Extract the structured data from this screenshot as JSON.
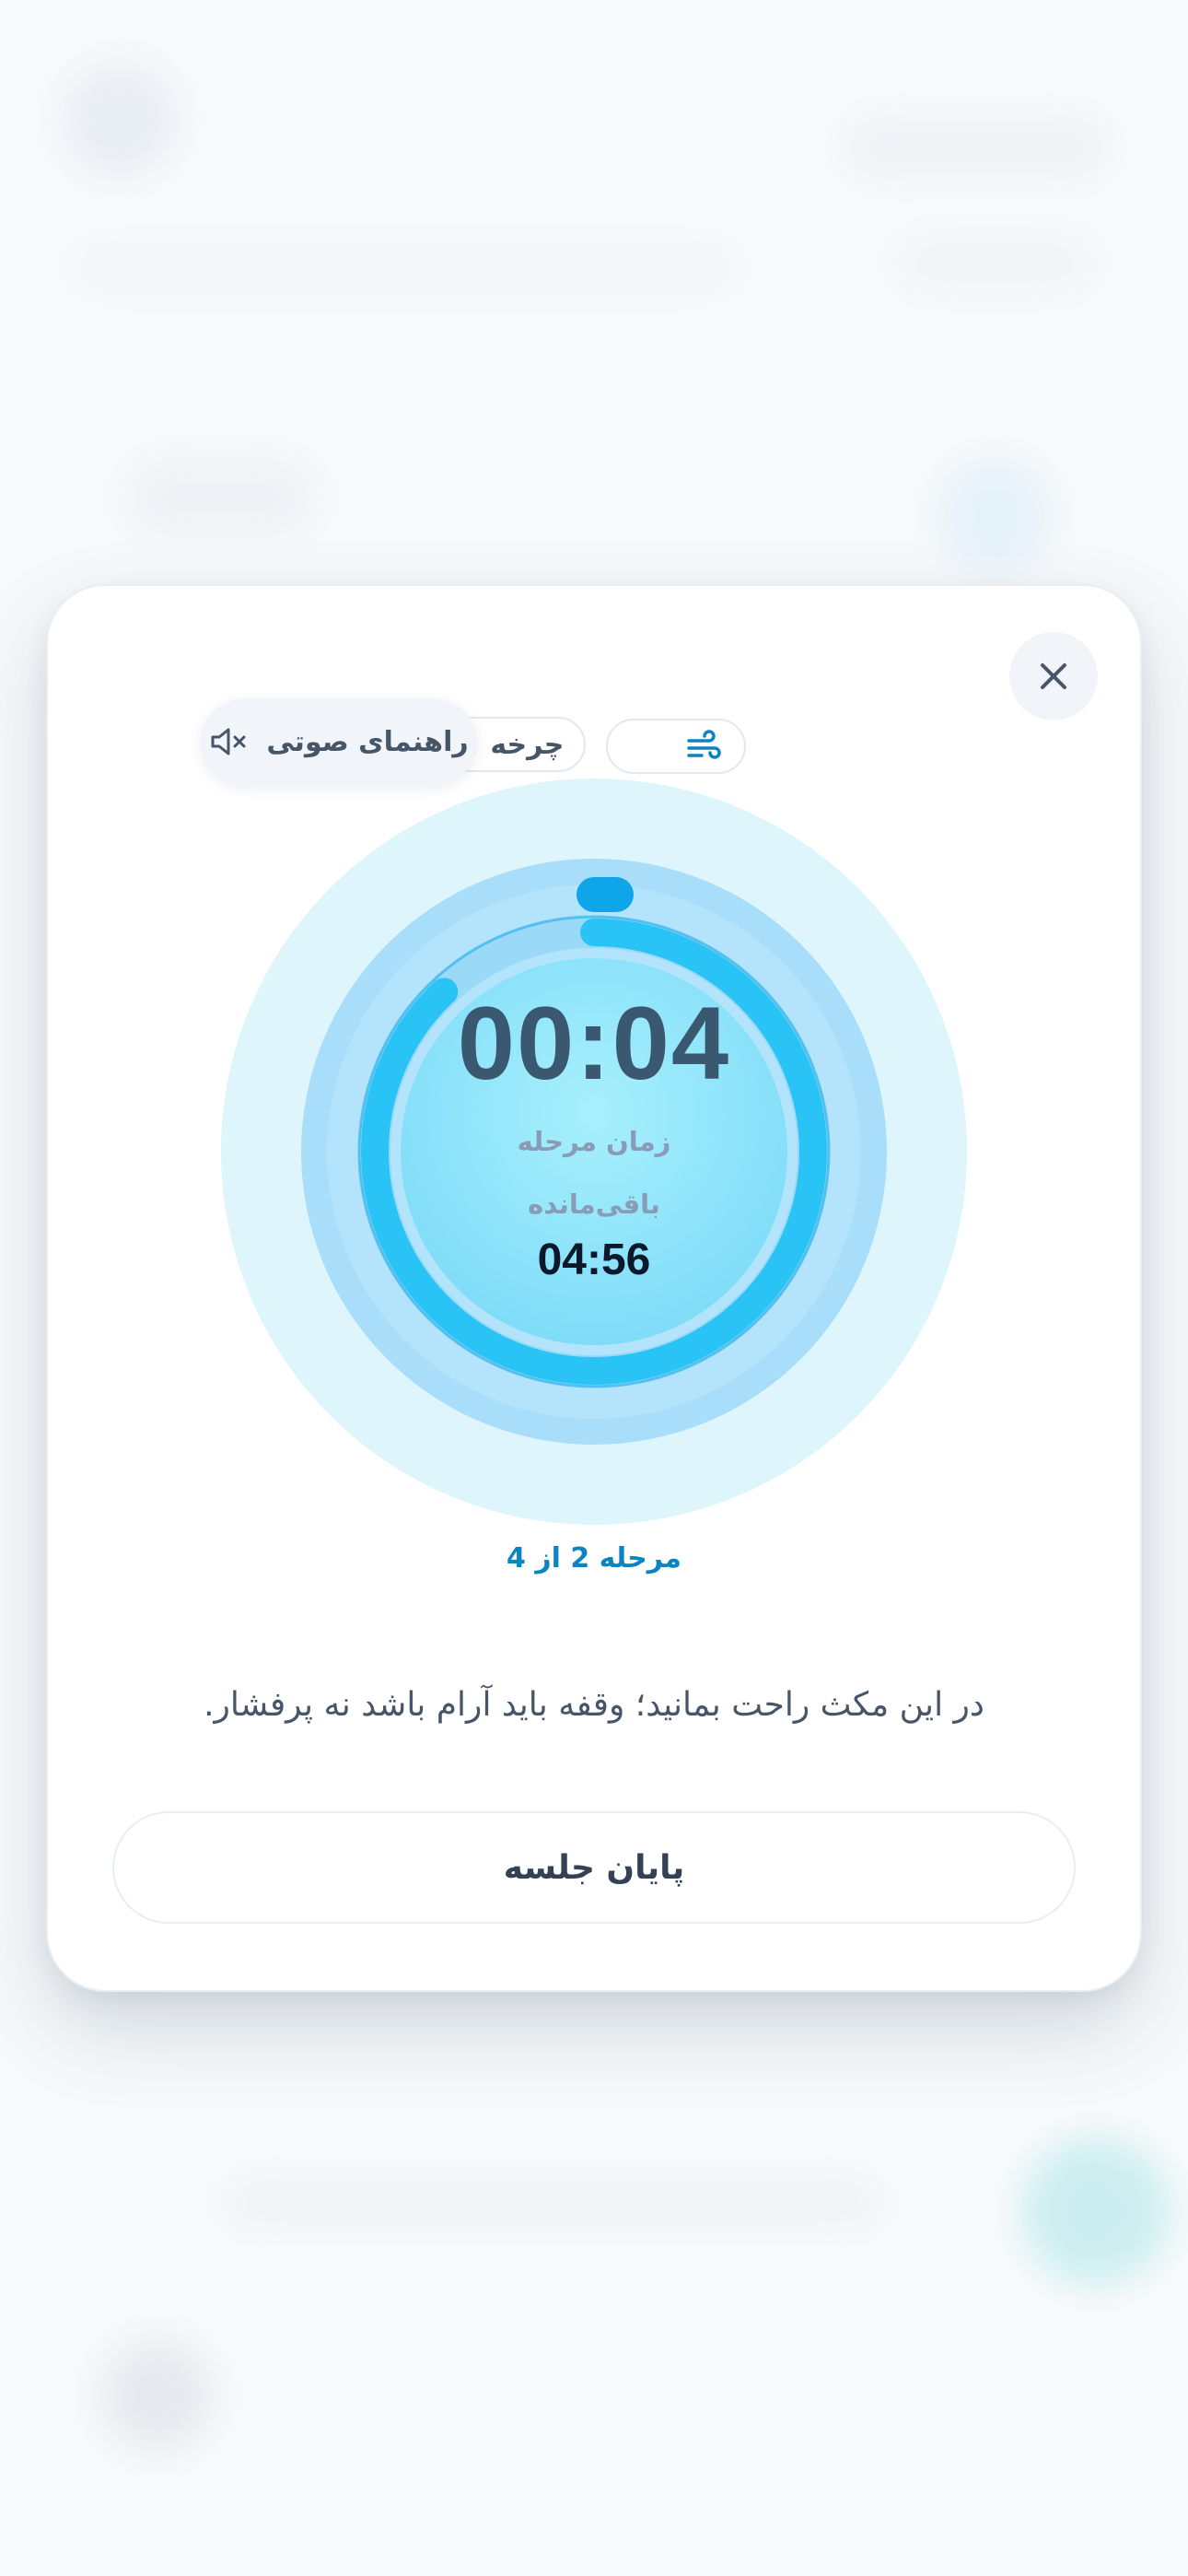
{
  "session": {
    "voice_guide_label": "راهنمای صوتی",
    "cycle_label": "چرخه ۱",
    "phase_time": "00:04",
    "phase_time_label": "زمان مرحله",
    "remaining_label": "باقی‌مانده",
    "remaining_time": "04:56",
    "step_progress": "مرحله 2 از 4",
    "instruction": "در این مکث راحت بمانید؛ وقفه باید آرام باشد نه پرفشار.",
    "end_button_label": "پایان جلسه",
    "phase_progress_fraction": 0.88
  },
  "colors": {
    "accent": "#0b84c2",
    "ring_progress": "#2ac3f5",
    "halo_outer": "#dcf4fc",
    "halo_mid": "#a9e0fb",
    "center_fill": "#9beafc"
  },
  "icons": {
    "close": "close-icon",
    "voice_muted": "speaker-muted-icon",
    "breath": "wind-icon"
  }
}
